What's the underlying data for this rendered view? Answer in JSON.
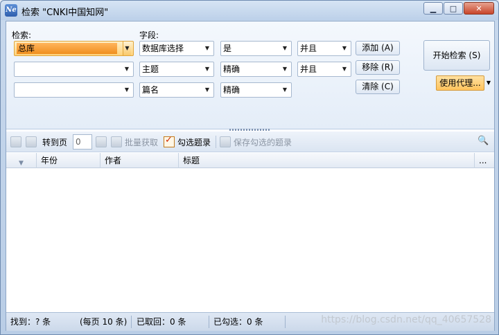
{
  "window": {
    "title": "检索 \"CNKI中国知网\"",
    "app_icon_label": "Ne",
    "minimize_icon": "minimize-icon",
    "maximize_icon": "maximize-icon",
    "close_icon": "close-icon"
  },
  "search": {
    "label_search": "检索:",
    "label_field": "字段:",
    "rows": [
      {
        "db": "总库",
        "field": "数据库选择",
        "match": "是",
        "logic": "并且"
      },
      {
        "db": "",
        "field": "主题",
        "match": "精确",
        "logic": "并且"
      },
      {
        "db": "",
        "field": "篇名",
        "match": "精确"
      }
    ],
    "buttons": {
      "add": "添加 (A)",
      "remove": "移除 (R)",
      "clear": "清除 (C)",
      "start": "开始检索 (S)",
      "proxy": "使用代理..."
    }
  },
  "toolbar": {
    "goto_page_label": "转到页",
    "page_value": "0",
    "batch_fetch": "批量获取",
    "select_records": "勾选题录",
    "save_selected": "保存勾选的题录"
  },
  "grid": {
    "columns": [
      "年份",
      "作者",
      "标题"
    ],
    "more": "..."
  },
  "status": {
    "found": "找到：? 条",
    "per_page": "(每页 10 条)",
    "fetched": "已取回：0 条",
    "selected": "已勾选：0 条"
  },
  "watermark": "https://blog.csdn.net/qq_40657528",
  "colors": {
    "accent_orange": "#ffc35c",
    "title_bar": "#bcd0e9",
    "close_red": "#c8452a"
  }
}
